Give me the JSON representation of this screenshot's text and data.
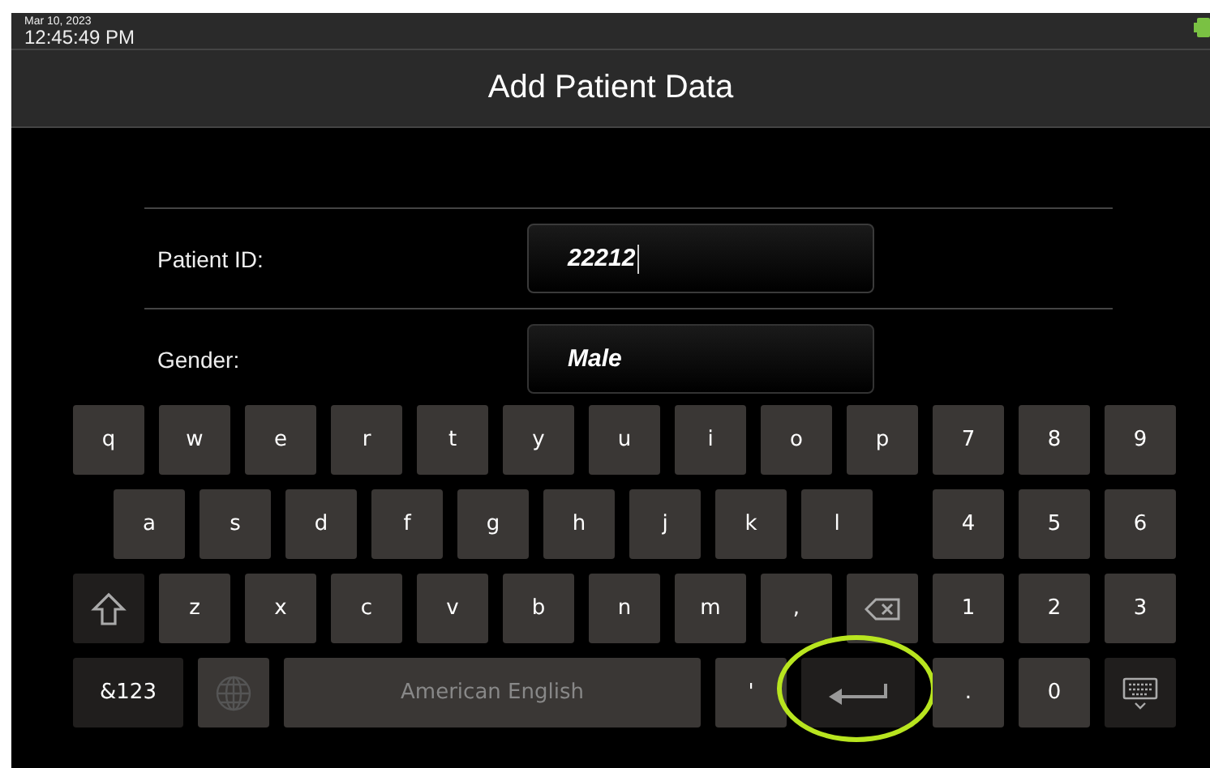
{
  "status_bar": {
    "date": "Mar 10, 2023",
    "time": "12:45:49 PM"
  },
  "title": "Add Patient Data",
  "form": {
    "rows": [
      {
        "label": "Patient ID:",
        "value": "22212",
        "focused": true
      },
      {
        "label": "Gender:",
        "value": "Male",
        "focused": false
      }
    ]
  },
  "keyboard": {
    "rows": [
      {
        "indent": false,
        "keys": [
          {
            "kind": "char",
            "label": "q"
          },
          {
            "kind": "char",
            "label": "w"
          },
          {
            "kind": "char",
            "label": "e"
          },
          {
            "kind": "char",
            "label": "r"
          },
          {
            "kind": "char",
            "label": "t"
          },
          {
            "kind": "char",
            "label": "y"
          },
          {
            "kind": "char",
            "label": "u"
          },
          {
            "kind": "char",
            "label": "i"
          },
          {
            "kind": "char",
            "label": "o"
          },
          {
            "kind": "char",
            "label": "p"
          }
        ],
        "pad": [
          {
            "kind": "char",
            "label": "7"
          },
          {
            "kind": "char",
            "label": "8"
          },
          {
            "kind": "char",
            "label": "9"
          }
        ]
      },
      {
        "indent": true,
        "keys": [
          {
            "kind": "char",
            "label": "a"
          },
          {
            "kind": "char",
            "label": "s"
          },
          {
            "kind": "char",
            "label": "d"
          },
          {
            "kind": "char",
            "label": "f"
          },
          {
            "kind": "char",
            "label": "g"
          },
          {
            "kind": "char",
            "label": "h"
          },
          {
            "kind": "char",
            "label": "j"
          },
          {
            "kind": "char",
            "label": "k"
          },
          {
            "kind": "char",
            "label": "l"
          }
        ],
        "pad": [
          {
            "kind": "char",
            "label": "4"
          },
          {
            "kind": "char",
            "label": "5"
          },
          {
            "kind": "char",
            "label": "6"
          }
        ]
      },
      {
        "indent": false,
        "keys": [
          {
            "kind": "shift"
          },
          {
            "kind": "char",
            "label": "z"
          },
          {
            "kind": "char",
            "label": "x"
          },
          {
            "kind": "char",
            "label": "c"
          },
          {
            "kind": "char",
            "label": "v"
          },
          {
            "kind": "char",
            "label": "b"
          },
          {
            "kind": "char",
            "label": "n"
          },
          {
            "kind": "char",
            "label": "m"
          },
          {
            "kind": "char",
            "label": ","
          },
          {
            "kind": "backspace"
          }
        ],
        "pad": [
          {
            "kind": "char",
            "label": "1"
          },
          {
            "kind": "char",
            "label": "2"
          },
          {
            "kind": "char",
            "label": "3"
          }
        ]
      },
      {
        "indent": false,
        "keys": [
          {
            "kind": "symbols",
            "label": "&123"
          },
          {
            "kind": "globe"
          },
          {
            "kind": "space",
            "label": "American English"
          },
          {
            "kind": "char",
            "label": "'"
          },
          {
            "kind": "enter",
            "highlighted": true
          }
        ],
        "pad": [
          {
            "kind": "char",
            "label": "."
          },
          {
            "kind": "char",
            "label": "0"
          },
          {
            "kind": "hide"
          }
        ]
      }
    ]
  }
}
